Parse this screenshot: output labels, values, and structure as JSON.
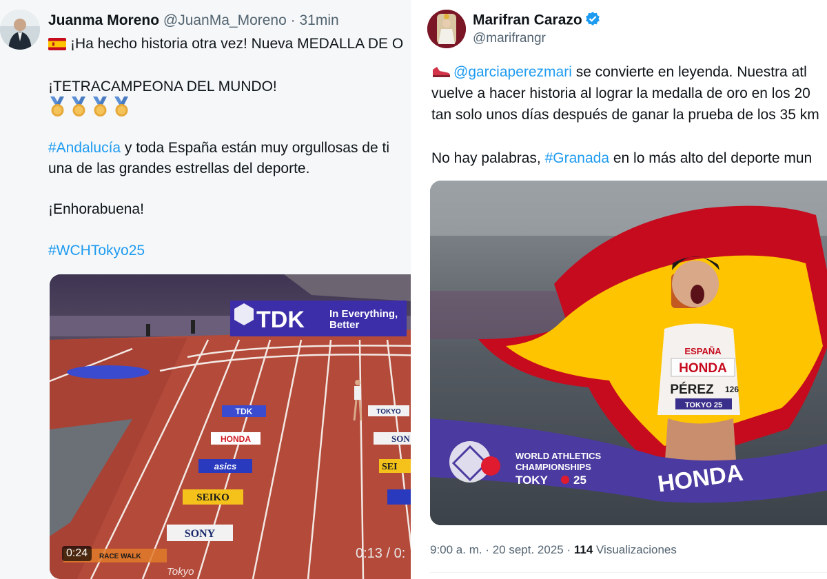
{
  "left_tweet": {
    "author_name": "Juanma Moreno",
    "handle": "@JuanMa_Moreno",
    "separator": "·",
    "time": "31min",
    "line1": "¡Ha hecho historia otra vez! Nueva MEDALLA DE O",
    "line2": "¡TETRACAMPEONA DEL MUNDO!",
    "hashtag_andalucia": "#Andalucía",
    "line3_rest": " y toda España están muy orgullosas de ti",
    "line4": "una de las grandes estrellas del deporte.",
    "line5": "¡Enhorabuena!",
    "hashtag_event": "#WCHTokyo25",
    "video": {
      "banner_brand": "TDK",
      "banner_slogan_1": "In Everything,",
      "banner_slogan_2": "Better",
      "board_tdk": "TDK",
      "board_honda": "HONDA",
      "board_asics": "asics",
      "board_seiko": "SEIKO",
      "board_sony": "SONY",
      "board_sony_right": "SON",
      "board_seiko_right": "SEI",
      "board_right_top": "TOKYO",
      "overlay_label": "RACE WALK",
      "duration": "0:24",
      "timecode": "0:13 / 0:",
      "watermark": "Tokyo"
    }
  },
  "right_tweet": {
    "author_name": "Marifran Carazo",
    "handle": "@marifrangr",
    "mention": "@garciaperezmari",
    "line1_rest": " se convierte en leyenda. Nuestra atl",
    "line2": "vuelve a hacer historia al lograr la medalla de oro en los 20",
    "line3": "tan solo unos días después de ganar la prueba de los 35 km",
    "line4_start": "No hay palabras, ",
    "hashtag_granada": "#Granada",
    "line4_rest": " en lo más alto del deporte mun",
    "photo": {
      "bib_top": "ESPAÑA",
      "bib_sponsor": "HONDA",
      "bib_name": "PÉREZ",
      "bib_number": "126",
      "bib_city": "TOKYO 25",
      "tape_text_1": "WORLD ATHLETICS",
      "tape_text_2": "CHAMPIONSHIPS",
      "tape_text_3": "TOKY",
      "tape_text_4": "25",
      "tape_honda": "HONDA"
    },
    "footer_time": "9:00 a. m.",
    "footer_sep": " · ",
    "footer_date": "20 sept. 2025",
    "footer_views_count": "114",
    "footer_views_label": " Visualizaciones"
  },
  "colors": {
    "link": "#1d9bf0",
    "muted": "#536471",
    "track": "#b44a3a",
    "tdk_banner": "#3b2ea8",
    "flag_red": "#c60b1e",
    "flag_yellow": "#ffc400"
  },
  "icons": [
    "spain-flag-icon",
    "gold-medal-icon",
    "verified-badge-icon",
    "shoe-icon"
  ]
}
